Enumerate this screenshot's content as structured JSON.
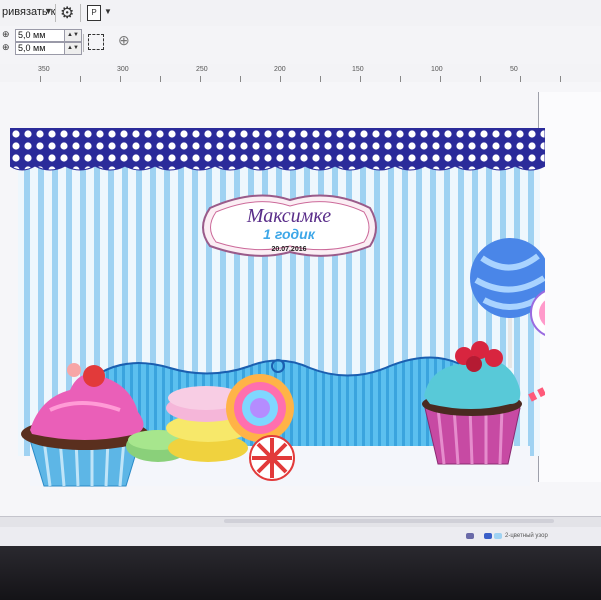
{
  "toolbar": {
    "snap_label": "ривязать к",
    "snap_arrow": "▼",
    "settings_icon": "gear-icon",
    "page_icon_letter": "P",
    "page_arrow": "▼"
  },
  "property_bar": {
    "dup_x_icon": "⊕",
    "dup_y_icon": "⊕",
    "dup_x_value": "5,0 мм",
    "dup_y_value": "5,0 мм",
    "spin_glyph": "▲▼"
  },
  "ruler": {
    "labels": [
      "350",
      "300",
      "250",
      "200",
      "150",
      "100",
      "50"
    ]
  },
  "design": {
    "name": "Максимке",
    "subtitle": "1 годик",
    "date": "20.07.2016"
  },
  "status_bar": {
    "fill_text": "2-цветный узор"
  },
  "colors": {
    "accent_blue": "#3ea7e8",
    "frame_purple": "#5a2e8a",
    "polka_navy": "#2b2b9a",
    "background_stripe": "#9fd2f2"
  }
}
